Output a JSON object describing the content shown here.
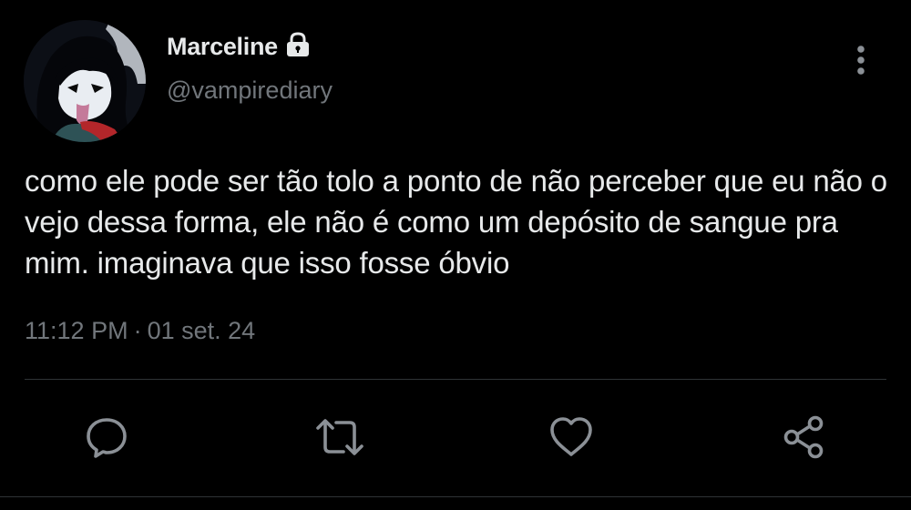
{
  "tweet": {
    "author": {
      "display_name": "Marceline",
      "handle": "@vampirediary",
      "protected": true,
      "badge_icon": "lock-icon"
    },
    "text": "como ele pode ser tão tolo a ponto de não perceber que eu não o vejo dessa forma, ele não é como um depósito de sangue pra mim. imaginava que isso fosse óbvio",
    "time": "11:12 PM",
    "separator": "·",
    "date": "01 set. 24"
  },
  "actions": [
    {
      "name": "reply",
      "icon": "comment-icon"
    },
    {
      "name": "retweet",
      "icon": "retweet-icon"
    },
    {
      "name": "like",
      "icon": "heart-icon"
    },
    {
      "name": "share",
      "icon": "share-icon"
    }
  ],
  "colors": {
    "background": "#000000",
    "primary_text": "#e7e9ea",
    "secondary_text": "#71767b",
    "divider": "#2f3336"
  }
}
